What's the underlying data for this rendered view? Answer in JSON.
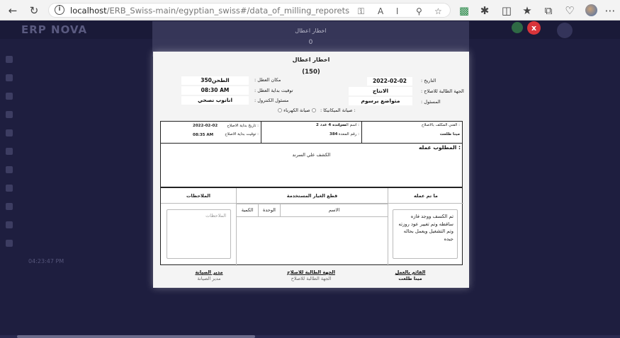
{
  "browser": {
    "url_host": "localhost",
    "url_path": "/ERB_Swiss-main/egyptian_swiss#/data_of_milling_reporets"
  },
  "app": {
    "brand": "ERP NOVA",
    "sidebar": [
      "",
      "",
      "",
      "",
      "",
      "",
      "",
      "",
      "",
      "",
      "",
      "",
      "",
      ""
    ],
    "sidebar_time": "04:23:47 PM",
    "close_label": "x"
  },
  "ghost_modal": {
    "title": "اخطار اعطال",
    "number": "0"
  },
  "report": {
    "title": "اخطار اعطال",
    "number": "(150)",
    "date_label": "التاريخ :",
    "date_value": "2022-02-02",
    "requesting_party_label": "الجهة الطالبة للاصلاح :",
    "requesting_party_value": "الانتاج",
    "responsible_label": "المسئول :",
    "responsible_value": "متواضع برسوم",
    "location_label": "مكان العطل :",
    "location_value": "الطحن350",
    "start_time_label": "توقيت بداية العطل :",
    "start_time_value": "08:30 AM",
    "controller_label": "مسئول الكنترول :",
    "controller_value": "انانوب نصحي",
    "maintenance_electrical": "صيانة الكهرباء :",
    "maintenance_mechanical": "صيانة الميكانيكا :",
    "tech_label": "الفني المكلف بالاصلاح :",
    "tech_value": "مينا طلعت",
    "equip_name_label": "اسم المعدة :",
    "equip_name_value": "سرانده 4 عدد 2",
    "equip_num_label": "رقم المعدة :",
    "equip_num_value": "384",
    "repair_date_label": "تاريخ بداية الاصلاح :",
    "repair_date_value": "2022-02-02",
    "repair_time_label": "توقيت بداية الاصلاح :",
    "repair_time_value": "08:35 AM",
    "required_label": "المطلوب عمله :",
    "required_value": "الكشف علي السرند",
    "done_header": "ما تم عمله",
    "done_value": "تم الكسف ووجد فازه ساقطه وتم تغيير عود روزته وتم التشغيل ويعمل بحاله جيده",
    "parts_header": "قطع الغيار المستخدمة",
    "parts_name": "الاسم",
    "parts_unit": "الوحدة",
    "parts_qty": "الكمية",
    "notes_header": "الملاحظات",
    "notes_placeholder": "الملاحظات",
    "sig_worker_title": "القائم بالعمل",
    "sig_worker_name": "مينا طلعت",
    "sig_party_title": "الجهة الطالبة للاصلاح",
    "sig_party_name": "الجهة الطالبة للاصلاح",
    "sig_manager_title": "مدير الصيانة",
    "sig_manager_name": "مدير الصيانة"
  }
}
